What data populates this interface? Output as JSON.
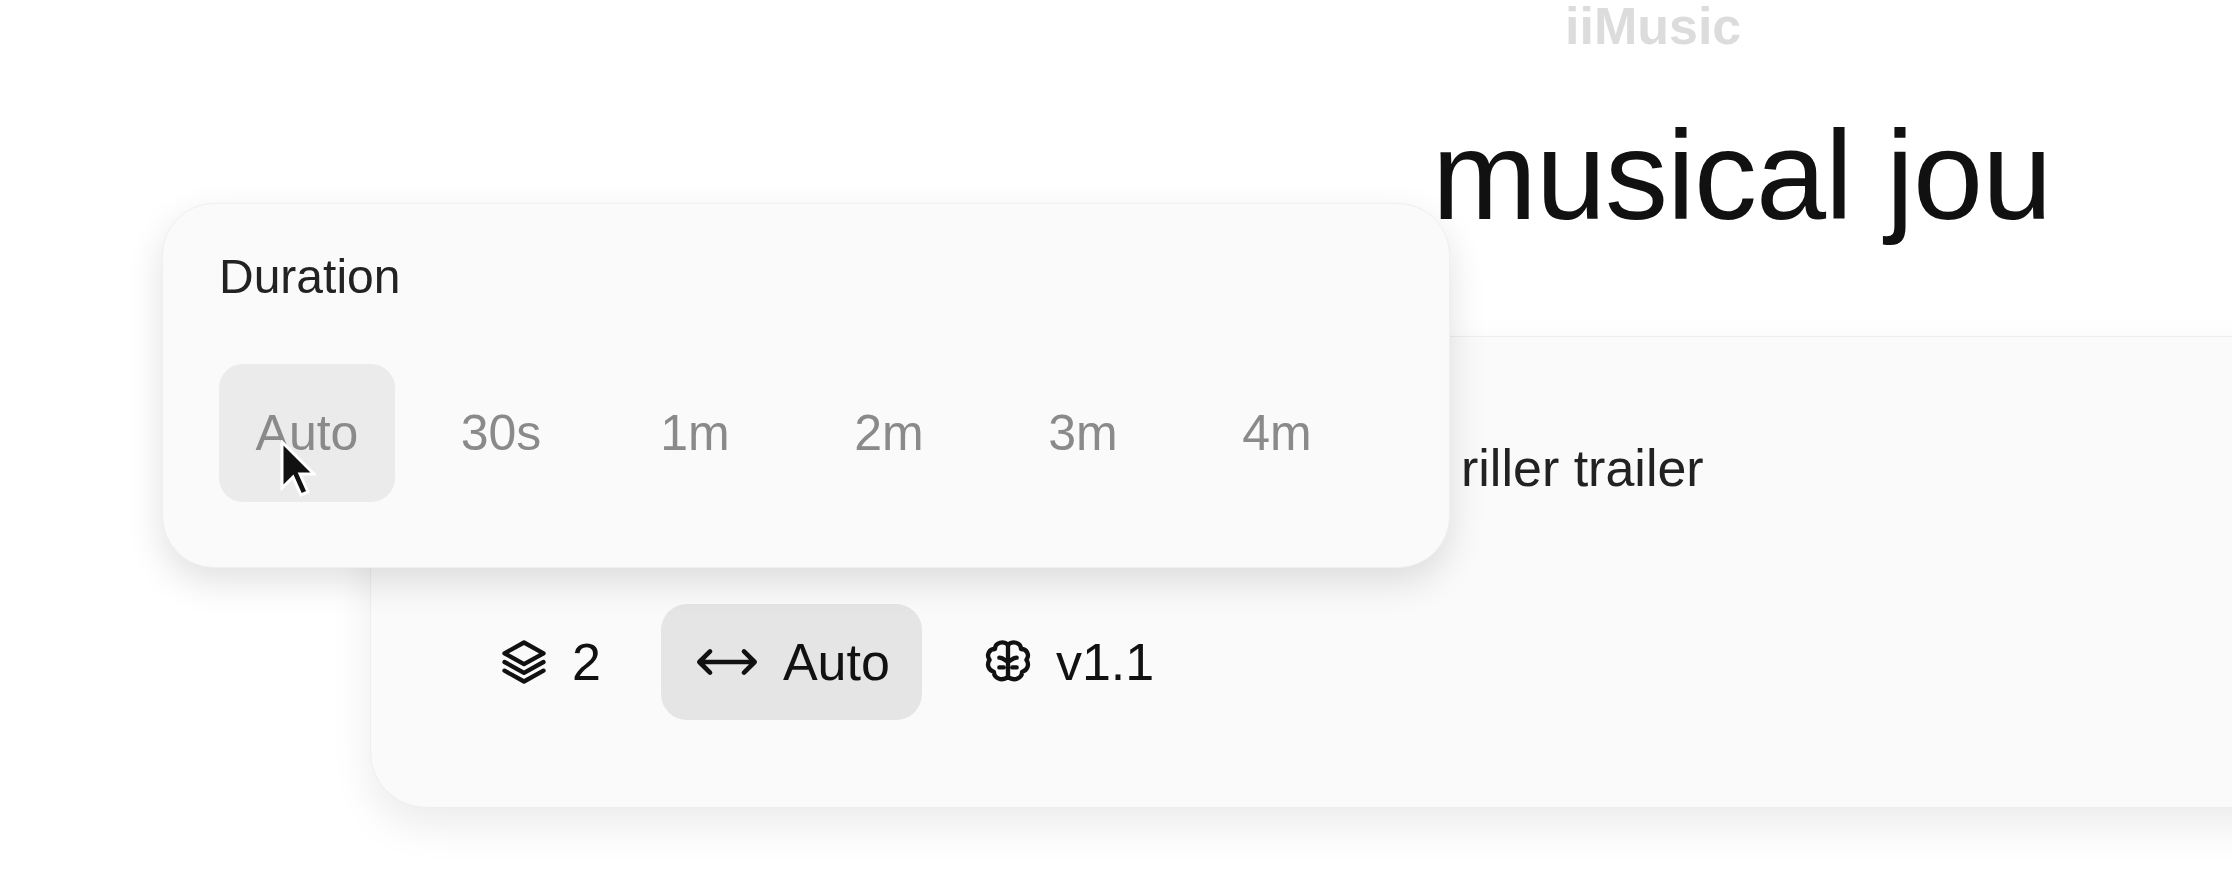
{
  "logo": "iiMusic",
  "headline": "musical jou",
  "prompt": {
    "text": "riller trailer"
  },
  "toolbar": [
    {
      "kind": "layers",
      "label": "2",
      "selected": false
    },
    {
      "kind": "width",
      "label": "Auto",
      "selected": true
    },
    {
      "kind": "model",
      "label": "v1.1",
      "selected": false
    }
  ],
  "duration_popover": {
    "title": "Duration",
    "options": [
      {
        "label": "Auto",
        "selected": true
      },
      {
        "label": "30s",
        "selected": false
      },
      {
        "label": "1m",
        "selected": false
      },
      {
        "label": "2m",
        "selected": false
      },
      {
        "label": "3m",
        "selected": false
      },
      {
        "label": "4m",
        "selected": false
      }
    ]
  }
}
